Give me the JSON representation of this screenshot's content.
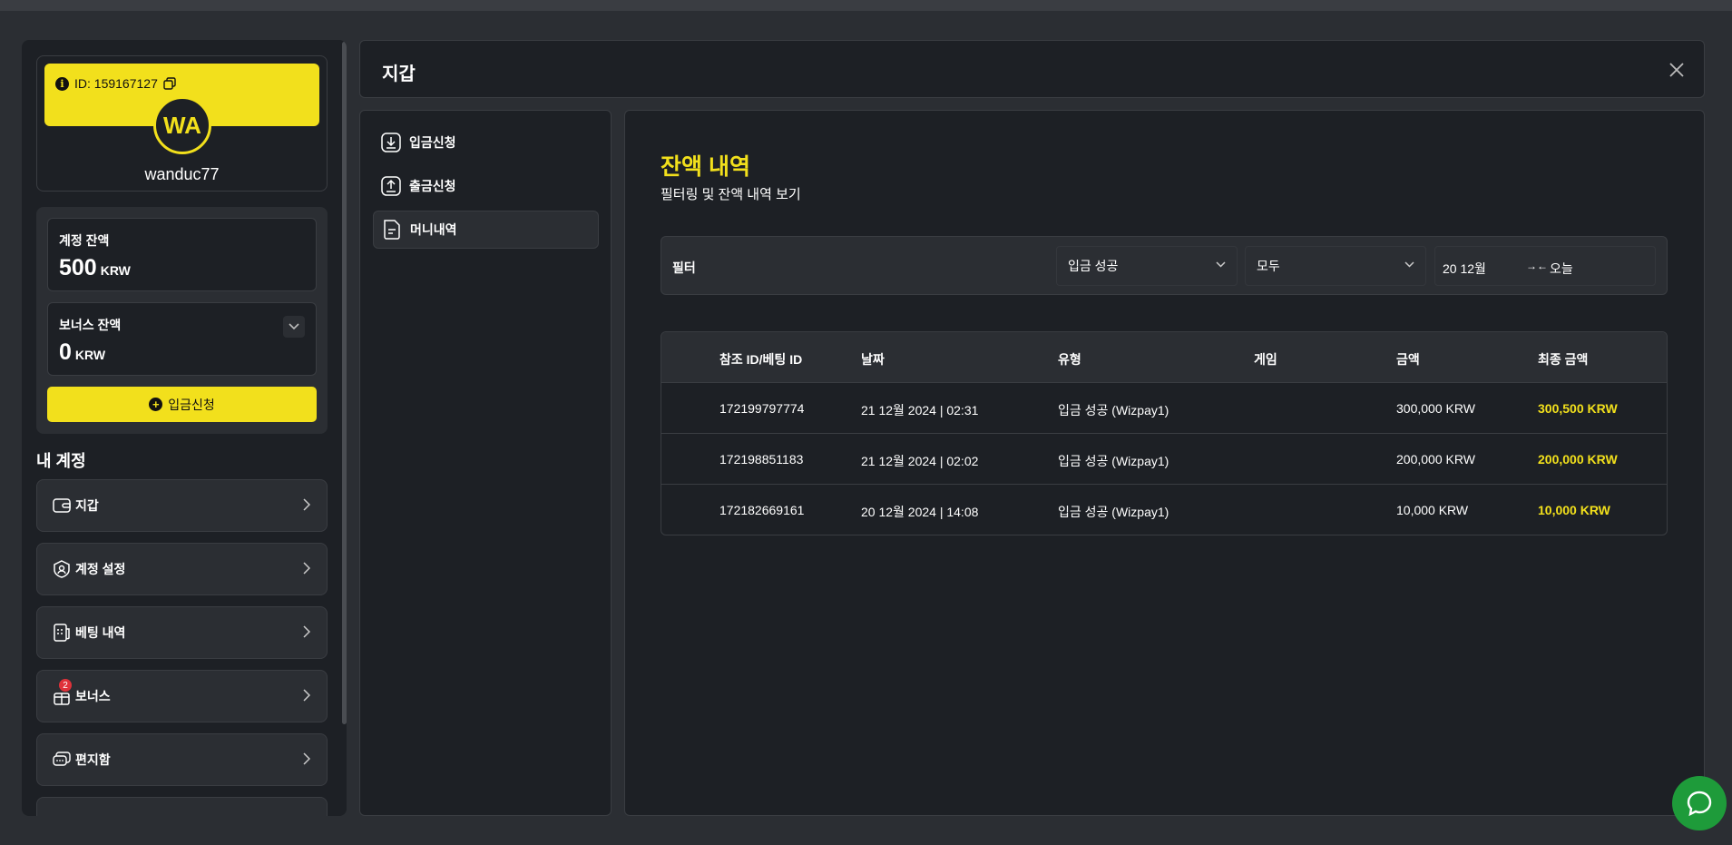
{
  "profile": {
    "id_label": "ID: 159167127",
    "avatar_initials": "WA",
    "username": "wanduc77"
  },
  "balances": {
    "account_label": "계정 잔액",
    "account_amount": "500",
    "account_currency": "KRW",
    "bonus_label": "보너스 잔액",
    "bonus_amount": "0",
    "bonus_currency": "KRW",
    "deposit_button": "입금신청"
  },
  "sidebar": {
    "section_title": "내 계정",
    "items": [
      {
        "label": "지갑",
        "icon": "wallet-icon"
      },
      {
        "label": "계정 설정",
        "icon": "user-shield-icon"
      },
      {
        "label": "베팅 내역",
        "icon": "receipt-icon"
      },
      {
        "label": "보너스",
        "icon": "gift-icon",
        "badge": "2"
      },
      {
        "label": "편지함",
        "icon": "chat-icon"
      }
    ]
  },
  "modal": {
    "title": "지갑"
  },
  "wallet_menu": [
    {
      "label": "입금신청",
      "icon": "download-icon"
    },
    {
      "label": "출금신청",
      "icon": "upload-icon"
    },
    {
      "label": "머니내역",
      "icon": "document-icon",
      "active": true
    }
  ],
  "content": {
    "title": "잔액 내역",
    "subtitle": "필터링 및 잔액 내역 보기",
    "filter": {
      "label": "필터",
      "status_select": "입금 성공",
      "type_select": "모두",
      "date_from": "20 12월",
      "date_to": "오늘"
    },
    "table": {
      "headers": [
        "참조 ID/베팅 ID",
        "날짜",
        "유형",
        "게임",
        "금액",
        "최종 금액"
      ],
      "rows": [
        [
          "172199797774",
          "21 12월 2024 | 02:31",
          "입금 성공 (Wizpay1)",
          "",
          "300,000 KRW",
          "300,500 KRW"
        ],
        [
          "172198851183",
          "21 12월 2024 | 02:02",
          "입금 성공 (Wizpay1)",
          "",
          "200,000 KRW",
          "200,000 KRW"
        ],
        [
          "172182669161",
          "20 12월 2024 | 14:08",
          "입금 성공 (Wizpay1)",
          "",
          "10,000 KRW",
          "10,000 KRW"
        ]
      ]
    }
  },
  "colors": {
    "accent": "#f2e01c",
    "background": "#2b2e33",
    "panel": "#1d2025",
    "chat": "#1e9b3a",
    "badge": "#e0323a"
  }
}
